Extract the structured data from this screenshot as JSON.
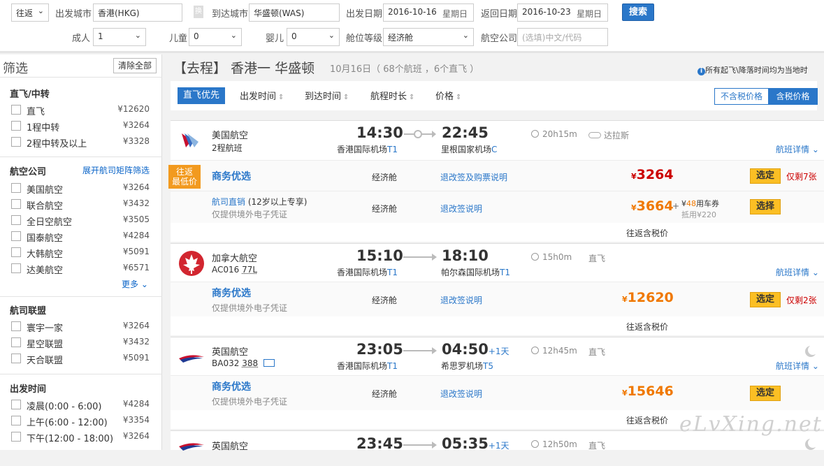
{
  "search": {
    "trip_type": "往返",
    "from_label": "出发城市",
    "from_value": "香港(HKG)",
    "swap_label": "换",
    "to_label": "到达城市",
    "to_value": "华盛顿(WAS)",
    "depart_label": "出发日期",
    "depart_value": "2016-10-16",
    "depart_weekday": "星期日",
    "return_label": "返回日期",
    "return_value": "2016-10-23",
    "return_weekday": "星期日",
    "search_button": "搜索",
    "adult_label": "成人",
    "adult_value": "1",
    "child_label": "儿童",
    "child_value": "0",
    "infant_label": "婴儿",
    "infant_value": "0",
    "cabin_label": "舱位等级",
    "cabin_value": "经济舱",
    "airline_label": "航空公司",
    "airline_placeholder": "(选填)中文/代码"
  },
  "sidebar": {
    "title": "筛选",
    "clear_all": "清除全部",
    "sections": [
      {
        "title": "直飞/中转",
        "options": [
          {
            "label": "直飞",
            "price": "¥12620"
          },
          {
            "label": "1程中转",
            "price": "¥3264"
          },
          {
            "label": "2程中转及以上",
            "price": "¥3328"
          }
        ]
      },
      {
        "title": "航空公司",
        "link": "展开航司矩阵筛选",
        "more": "更多",
        "options": [
          {
            "label": "美国航空",
            "price": "¥3264"
          },
          {
            "label": "联合航空",
            "price": "¥3432"
          },
          {
            "label": "全日空航空",
            "price": "¥3505"
          },
          {
            "label": "国泰航空",
            "price": "¥4284"
          },
          {
            "label": "大韩航空",
            "price": "¥5091"
          },
          {
            "label": "达美航空",
            "price": "¥6571"
          }
        ]
      },
      {
        "title": "航司联盟",
        "options": [
          {
            "label": "寰宇一家",
            "price": "¥3264"
          },
          {
            "label": "星空联盟",
            "price": "¥3432"
          },
          {
            "label": "天合联盟",
            "price": "¥5091"
          }
        ]
      },
      {
        "title": "出发时间",
        "options": [
          {
            "label": "凌晨(0:00 - 6:00)",
            "price": "¥4284"
          },
          {
            "label": "上午(6:00 - 12:00)",
            "price": "¥3354"
          },
          {
            "label": "下午(12:00 - 18:00)",
            "price": "¥3264"
          }
        ]
      }
    ]
  },
  "route": {
    "title": "【去程】 香港一 华盛顿",
    "subtitle": "10月16日（ 68个航班 ，6个直飞 ）",
    "note": "所有起飞\\降落时间均为当地时"
  },
  "sortbar": {
    "active": "直飞优先",
    "items": [
      "出发时间",
      "到达时间",
      "航程时长",
      "价格"
    ],
    "tax_excl": "不含税价格",
    "tax_incl": "含税价格"
  },
  "flights": [
    {
      "airline": "美国航空",
      "flight_no": "2程航班",
      "dep_time": "14:30",
      "arr_time": "22:45",
      "dep_airport": "香港国际机场",
      "dep_term": "T1",
      "arr_airport": "里根国家机场",
      "arr_term": "C",
      "duration": "20h15m",
      "stop": "达拉斯",
      "detail": "航班详情",
      "badge": [
        "往返",
        "最低价"
      ],
      "offers": [
        {
          "title": "商务优选",
          "cabin": "经济舱",
          "rule": "退改签及购票说明",
          "price": "3264",
          "button": "选定",
          "remain": "仅剩7张"
        },
        {
          "title": "航司直销",
          "title_extra": "(12岁以上专享)",
          "sub": "仅提供境外电子凭证",
          "cabin": "经济舱",
          "rule": "退改签说明",
          "price": "3664",
          "coupon_amount": "48",
          "coupon_label": "用车券",
          "coupon_sub": "抵用¥220",
          "button": "选择"
        }
      ],
      "tax_note": "往返含税价"
    },
    {
      "airline": "加拿大航空",
      "flight_no": "AC016",
      "aircraft": "77L",
      "dep_time": "15:10",
      "arr_time": "18:10",
      "dep_airport": "香港国际机场",
      "dep_term": "T1",
      "arr_airport": "帕尔森国际机场",
      "arr_term": "T1",
      "duration": "15h0m",
      "stop": "直飞",
      "detail": "航班详情",
      "offers": [
        {
          "title": "商务优选",
          "sub": "仅提供境外电子凭证",
          "cabin": "经济舱",
          "rule": "退改签说明",
          "price": "12620",
          "button": "选定",
          "remain": "仅剩2张"
        }
      ],
      "tax_note": "往返含税价"
    },
    {
      "airline": "英国航空",
      "flight_no": "BA032",
      "aircraft": "388",
      "dep_time": "23:05",
      "arr_time": "04:50",
      "arr_plus": "+1天",
      "dep_airport": "香港国际机场",
      "dep_term": "T1",
      "arr_airport": "希思罗机场",
      "arr_term": "T5",
      "duration": "12h45m",
      "stop": "直飞",
      "detail": "航班详情",
      "offers": [
        {
          "title": "商务优选",
          "sub": "仅提供境外电子凭证",
          "cabin": "经济舱",
          "rule": "退改签说明",
          "price": "15646",
          "button": "选定"
        }
      ],
      "tax_note": "往返含税价"
    },
    {
      "airline": "英国航空",
      "dep_time": "23:45",
      "arr_time": "05:35",
      "arr_plus": "+1天",
      "duration": "12h50m",
      "stop": "直飞"
    }
  ],
  "currency": "¥",
  "watermark": "eLvXing.net",
  "colors": {
    "accent": "#2a77c9",
    "price_red": "#cc0000",
    "price_orange": "#f07800",
    "button_yellow": "#fbbf24",
    "badge_orange": "#f29a1f"
  }
}
